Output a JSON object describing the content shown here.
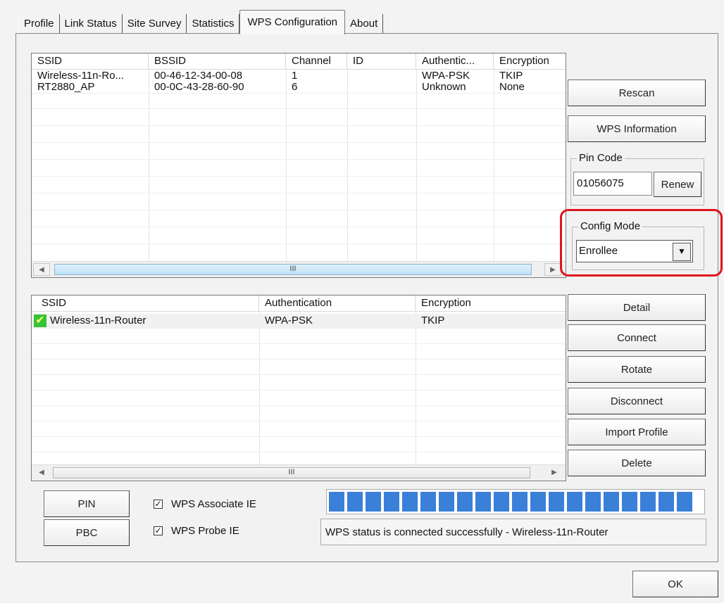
{
  "tabs": [
    "Profile",
    "Link Status",
    "Site Survey",
    "Statistics",
    "WPS Configuration",
    "About"
  ],
  "active_tab": "WPS Configuration",
  "ap_table": {
    "columns": [
      "SSID",
      "BSSID",
      "Channel",
      "ID",
      "Authentic...",
      "Encryption"
    ],
    "rows": [
      [
        "Wireless-11n-Ro...",
        "00-46-12-34-00-08",
        "1",
        "",
        "WPA-PSK",
        "TKIP"
      ],
      [
        "RT2880_AP",
        "00-0C-43-28-60-90",
        "6",
        "",
        "Unknown",
        "None"
      ]
    ],
    "scroll_grip": "III"
  },
  "profile_table": {
    "columns": [
      "SSID",
      "Authentication",
      "Encryption"
    ],
    "rows": [
      [
        "Wireless-11n-Router",
        "WPA-PSK",
        "TKIP"
      ]
    ],
    "scroll_grip": "III"
  },
  "buttons": {
    "rescan": "Rescan",
    "wps_information": "WPS Information",
    "renew": "Renew",
    "detail": "Detail",
    "connect": "Connect",
    "rotate": "Rotate",
    "disconnect": "Disconnect",
    "import_profile": "Import Profile",
    "delete": "Delete",
    "pin": "PIN",
    "pbc": "PBC",
    "ok": "OK"
  },
  "pin_code": {
    "label": "Pin Code",
    "value": "01056075"
  },
  "config_mode": {
    "label": "Config Mode",
    "selected": "Enrollee"
  },
  "checkboxes": {
    "wps_associate_ie": {
      "label": "WPS Associate IE",
      "checked": true
    },
    "wps_probe_ie": {
      "label": "WPS Probe IE",
      "checked": true
    }
  },
  "progress_fraction": 1.0,
  "status_text": "WPS status is connected successfully - Wireless-11n-Router",
  "colors": {
    "highlight_border": "#e0141e",
    "progress_block": "#3a7fd8",
    "connected_icon": "#36c336"
  },
  "icons": {
    "connected": "check-icon",
    "scroll_left": "arrow-left-icon",
    "scroll_right": "arrow-right-icon",
    "dropdown": "arrow-down-icon"
  }
}
